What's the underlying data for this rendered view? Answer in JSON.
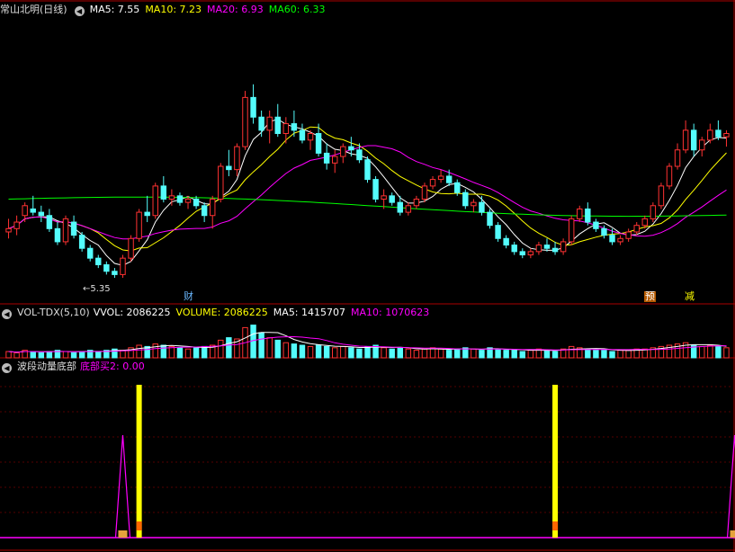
{
  "colors": {
    "background": "#000000",
    "up": "#ff3232",
    "down": "#54fcfc",
    "ma5": "#ffffff",
    "ma10": "#ffff00",
    "ma20": "#ff00ff",
    "ma60": "#00ff00",
    "separator": "#aa0000",
    "grid": "#550000",
    "bar": "#ffff00",
    "spike": "#ff00ff"
  },
  "main_panel": {
    "title": "常山北明(日线)",
    "ma_labels": [
      {
        "text": "MA5: 7.55",
        "color": "#ffffff"
      },
      {
        "text": "MA10: 7.23",
        "color": "#ffff00"
      },
      {
        "text": "MA20: 6.93",
        "color": "#ff00ff"
      },
      {
        "text": "MA60: 6.33",
        "color": "#00ff00"
      }
    ],
    "low_label": "5.35",
    "event_markers": [
      {
        "text": "财",
        "color": "#6ab8ff"
      },
      {
        "text": "预",
        "color": "#ff8c00"
      },
      {
        "text": "减",
        "color": "#ffff00"
      }
    ]
  },
  "volume_panel": {
    "title": "VOL-TDX(5,10)",
    "labels": [
      {
        "text": "VVOL: 2086225",
        "color": "#ffffff"
      },
      {
        "text": "VOLUME: 2086225",
        "color": "#ffff00"
      },
      {
        "text": "MA5: 1415707",
        "color": "#ffffff"
      },
      {
        "text": "MA10: 1070623",
        "color": "#ff00ff"
      }
    ]
  },
  "indicator_panel": {
    "title": "波段动量底部",
    "labels": [
      {
        "text": "底部买2: 0.00",
        "color": "#ff00ff"
      }
    ]
  },
  "chart_data": {
    "type": "candlestick",
    "candles": [
      [
        6.05,
        6.25,
        5.95,
        6.1
      ],
      [
        6.1,
        6.3,
        6.0,
        6.2
      ],
      [
        6.3,
        6.5,
        6.2,
        6.45
      ],
      [
        6.4,
        6.6,
        6.3,
        6.35
      ],
      [
        6.35,
        6.45,
        6.2,
        6.3
      ],
      [
        6.3,
        6.4,
        6.05,
        6.1
      ],
      [
        6.1,
        6.2,
        5.85,
        5.9
      ],
      [
        5.9,
        6.3,
        5.85,
        6.25
      ],
      [
        6.2,
        6.3,
        5.95,
        6.0
      ],
      [
        6.0,
        6.05,
        5.75,
        5.8
      ],
      [
        5.8,
        5.85,
        5.6,
        5.65
      ],
      [
        5.65,
        5.7,
        5.5,
        5.55
      ],
      [
        5.55,
        5.6,
        5.4,
        5.45
      ],
      [
        5.45,
        5.5,
        5.35,
        5.4
      ],
      [
        5.4,
        5.7,
        5.35,
        5.65
      ],
      [
        5.65,
        6.0,
        5.6,
        5.95
      ],
      [
        5.95,
        6.4,
        5.9,
        6.35
      ],
      [
        6.35,
        6.6,
        6.2,
        6.3
      ],
      [
        6.3,
        6.8,
        6.25,
        6.75
      ],
      [
        6.75,
        6.9,
        6.5,
        6.55
      ],
      [
        6.55,
        6.7,
        6.45,
        6.6
      ],
      [
        6.6,
        6.65,
        6.45,
        6.5
      ],
      [
        6.5,
        6.6,
        6.4,
        6.55
      ],
      [
        6.55,
        6.6,
        6.4,
        6.45
      ],
      [
        6.45,
        6.5,
        6.2,
        6.3
      ],
      [
        6.3,
        6.6,
        6.1,
        6.55
      ],
      [
        6.55,
        7.1,
        6.5,
        7.05
      ],
      [
        7.05,
        7.3,
        6.9,
        7.0
      ],
      [
        7.0,
        7.4,
        6.9,
        7.35
      ],
      [
        7.35,
        8.2,
        7.3,
        8.1
      ],
      [
        8.1,
        8.3,
        7.7,
        7.8
      ],
      [
        7.8,
        7.9,
        7.5,
        7.6
      ],
      [
        7.6,
        7.9,
        7.4,
        7.8
      ],
      [
        7.8,
        8.0,
        7.5,
        7.55
      ],
      [
        7.55,
        7.8,
        7.4,
        7.7
      ],
      [
        7.7,
        7.9,
        7.5,
        7.6
      ],
      [
        7.6,
        7.7,
        7.4,
        7.45
      ],
      [
        7.45,
        7.6,
        7.3,
        7.55
      ],
      [
        7.55,
        7.7,
        7.2,
        7.25
      ],
      [
        7.25,
        7.4,
        7.0,
        7.1
      ],
      [
        7.1,
        7.3,
        6.95,
        7.2
      ],
      [
        7.2,
        7.4,
        7.1,
        7.35
      ],
      [
        7.35,
        7.5,
        7.2,
        7.3
      ],
      [
        7.3,
        7.4,
        7.1,
        7.15
      ],
      [
        7.15,
        7.2,
        6.8,
        6.85
      ],
      [
        6.85,
        6.9,
        6.5,
        6.55
      ],
      [
        6.55,
        6.7,
        6.4,
        6.6
      ],
      [
        6.6,
        6.65,
        6.45,
        6.5
      ],
      [
        6.5,
        6.6,
        6.3,
        6.35
      ],
      [
        6.35,
        6.5,
        6.3,
        6.45
      ],
      [
        6.45,
        6.6,
        6.4,
        6.55
      ],
      [
        6.55,
        6.8,
        6.5,
        6.75
      ],
      [
        6.75,
        6.9,
        6.7,
        6.85
      ],
      [
        6.85,
        7.0,
        6.8,
        6.9
      ],
      [
        6.9,
        7.0,
        6.75,
        6.8
      ],
      [
        6.8,
        6.85,
        6.6,
        6.65
      ],
      [
        6.65,
        6.7,
        6.4,
        6.45
      ],
      [
        6.45,
        6.55,
        6.35,
        6.5
      ],
      [
        6.5,
        6.6,
        6.3,
        6.35
      ],
      [
        6.35,
        6.4,
        6.1,
        6.15
      ],
      [
        6.15,
        6.2,
        5.9,
        5.95
      ],
      [
        5.95,
        6.0,
        5.8,
        5.85
      ],
      [
        5.85,
        5.9,
        5.7,
        5.75
      ],
      [
        5.75,
        5.8,
        5.65,
        5.7
      ],
      [
        5.7,
        5.8,
        5.65,
        5.75
      ],
      [
        5.75,
        5.9,
        5.7,
        5.85
      ],
      [
        5.85,
        5.95,
        5.75,
        5.8
      ],
      [
        5.8,
        5.9,
        5.7,
        5.75
      ],
      [
        5.75,
        5.95,
        5.7,
        5.9
      ],
      [
        5.9,
        6.3,
        5.85,
        6.25
      ],
      [
        6.25,
        6.45,
        6.2,
        6.4
      ],
      [
        6.4,
        6.5,
        6.15,
        6.2
      ],
      [
        6.2,
        6.25,
        6.05,
        6.1
      ],
      [
        6.1,
        6.15,
        5.95,
        6.0
      ],
      [
        6.0,
        6.1,
        5.85,
        5.9
      ],
      [
        5.9,
        6.0,
        5.85,
        5.95
      ],
      [
        5.95,
        6.1,
        5.9,
        6.05
      ],
      [
        6.05,
        6.2,
        6.0,
        6.15
      ],
      [
        6.15,
        6.3,
        6.1,
        6.25
      ],
      [
        6.25,
        6.5,
        6.2,
        6.45
      ],
      [
        6.45,
        6.8,
        6.4,
        6.75
      ],
      [
        6.75,
        7.1,
        6.7,
        7.05
      ],
      [
        7.05,
        7.4,
        7.0,
        7.3
      ],
      [
        7.3,
        7.75,
        7.25,
        7.6
      ],
      [
        7.6,
        7.7,
        7.2,
        7.3
      ],
      [
        7.3,
        7.5,
        7.2,
        7.45
      ],
      [
        7.45,
        7.7,
        7.4,
        7.6
      ],
      [
        7.6,
        7.75,
        7.45,
        7.5
      ],
      [
        7.5,
        7.6,
        7.35,
        7.55
      ]
    ],
    "ma_series": [
      {
        "name": "MA5",
        "color": "#ffffff",
        "period": 5
      },
      {
        "name": "MA10",
        "color": "#ffff00",
        "period": 10
      },
      {
        "name": "MA20",
        "color": "#ff00ff",
        "period": 20
      },
      {
        "name": "MA60",
        "color": "#00ff00",
        "values_start": 6.55,
        "values_end": 6.33
      }
    ],
    "price_range": [
      5.2,
      8.9
    ],
    "volume": [
      5,
      4,
      6,
      5,
      4,
      5,
      6,
      5,
      4,
      5,
      6,
      5,
      6,
      7,
      6,
      8,
      10,
      9,
      11,
      10,
      9,
      8,
      7,
      8,
      9,
      10,
      14,
      16,
      15,
      24,
      26,
      20,
      16,
      14,
      12,
      11,
      10,
      9,
      10,
      9,
      8,
      9,
      8,
      7,
      9,
      10,
      8,
      7,
      8,
      7,
      6,
      7,
      8,
      7,
      6,
      7,
      8,
      7,
      6,
      8,
      7,
      6,
      6,
      5,
      6,
      7,
      6,
      5,
      7,
      9,
      8,
      7,
      6,
      6,
      5,
      6,
      6,
      7,
      7,
      8,
      9,
      10,
      11,
      12,
      10,
      9,
      10,
      9,
      8
    ],
    "volume_max": 30,
    "indicator": {
      "yellow_bars": [
        16,
        67
      ],
      "magenta_spikes": [
        14,
        89
      ]
    }
  }
}
